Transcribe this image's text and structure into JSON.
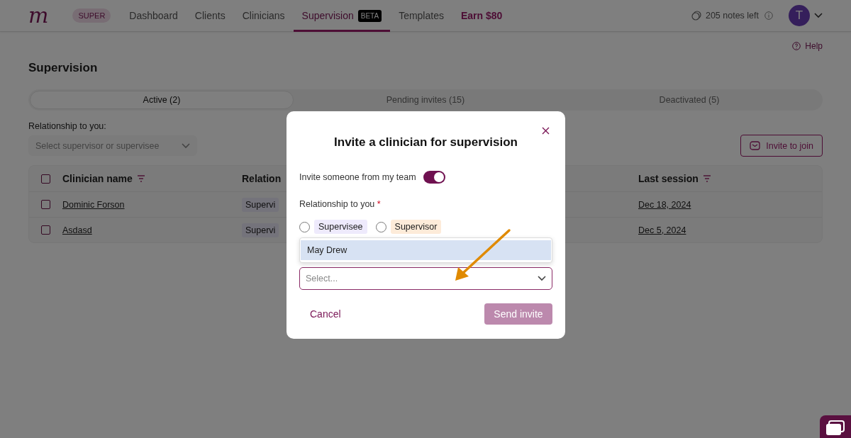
{
  "nav": {
    "logo": "m",
    "plan_badge": "SUPER",
    "items": [
      {
        "label": "Dashboard",
        "selected": false,
        "kind": "link"
      },
      {
        "label": "Clients",
        "selected": false,
        "kind": "link"
      },
      {
        "label": "Clinicians",
        "selected": false,
        "kind": "link"
      },
      {
        "label": "Supervision",
        "selected": true,
        "kind": "link",
        "badge": "BETA"
      },
      {
        "label": "Templates",
        "selected": false,
        "kind": "link"
      },
      {
        "label": "Earn $80",
        "selected": false,
        "kind": "promo"
      }
    ],
    "notes_left": "205 notes left",
    "avatar_initial": "T"
  },
  "help": "Help",
  "title": "Supervision",
  "tabs": [
    {
      "label": "Active (2)",
      "selected": true
    },
    {
      "label": "Pending invites (15)",
      "selected": false
    },
    {
      "label": "Deactivated (5)",
      "selected": false
    }
  ],
  "filter": {
    "label": "Relationship to you:",
    "placeholder": "Select supervisor or supervisee"
  },
  "invite_button": "Invite to join",
  "table": {
    "header_checked": false,
    "columns": [
      {
        "label": "Clinician name",
        "sortable": true
      },
      {
        "label": "Relation"
      },
      {
        "label": "Last session",
        "sortable": true
      }
    ],
    "rows": [
      {
        "checked": false,
        "name": "Dominic Forson",
        "relationship": "Supervi",
        "last_session": "Dec 18, 2024"
      },
      {
        "checked": false,
        "name": "Asdasd",
        "relationship": "Supervi",
        "last_session": "Dec 5, 2024"
      }
    ]
  },
  "modal": {
    "title": "Invite a clinician for supervision",
    "toggle": {
      "label": "Invite someone from my team",
      "on": true
    },
    "relationship": {
      "label": "Relationship to you",
      "required_mark": "*",
      "options": [
        {
          "label": "Supervisee",
          "selected": false,
          "color": "#eeeafc"
        },
        {
          "label": "Supervisor",
          "selected": false,
          "color": "#fdebd9"
        }
      ]
    },
    "dropdown": {
      "options": [
        {
          "label": "May Drew",
          "highlighted": true
        }
      ]
    },
    "select": {
      "placeholder": "Select..."
    },
    "cancel": "Cancel",
    "send": {
      "label": "Send invite",
      "disabled": true
    }
  }
}
